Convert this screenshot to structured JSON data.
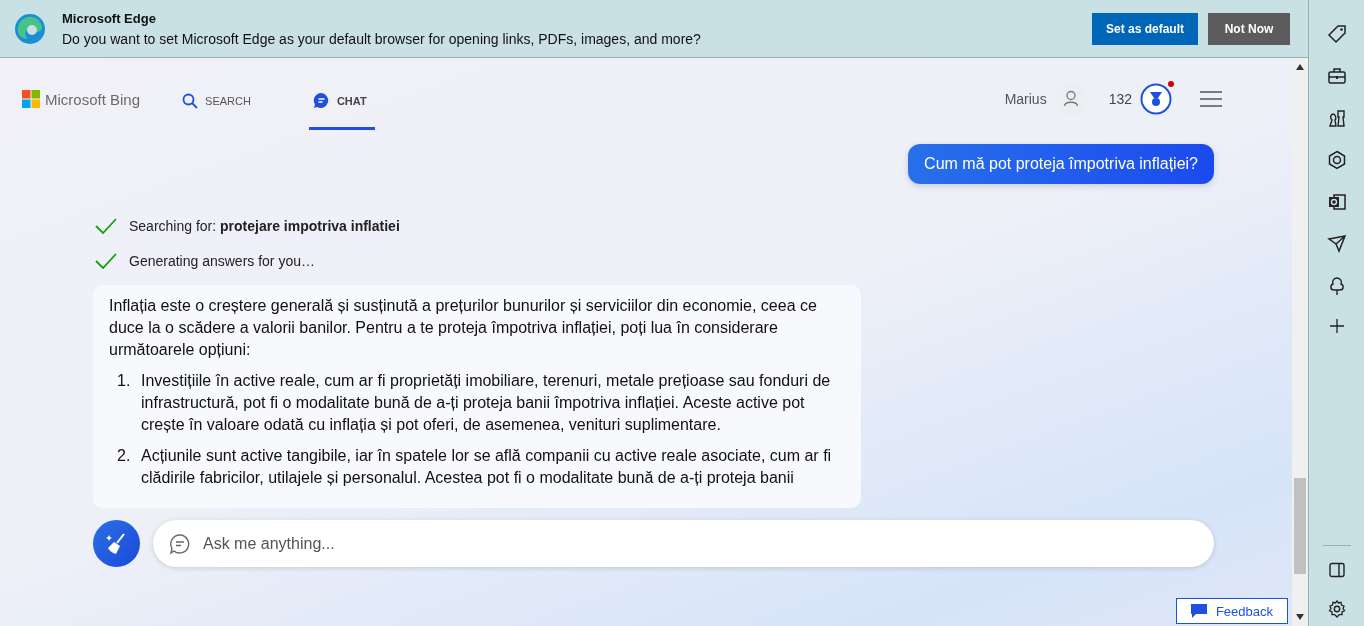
{
  "banner": {
    "title": "Microsoft Edge",
    "message": "Do you want to set Microsoft Edge as your default browser for opening links, PDFs, images, and more?",
    "buttons": [
      {
        "label": "Set as default",
        "kind": "primary"
      },
      {
        "label": "Not Now",
        "kind": "secondary"
      }
    ]
  },
  "header": {
    "logo": "Microsoft Bing",
    "tabs": [
      {
        "label": "SEARCH",
        "selected": false
      },
      {
        "label": "CHAT",
        "selected": true
      }
    ],
    "user": "Marius",
    "points": "132",
    "rewards_notification": true
  },
  "chat": {
    "user_message": "Cum mă pot proteja împotriva inflației?",
    "steps": [
      {
        "text": "Searching for: **protejare impotriva inflatiei**",
        "done": true
      },
      {
        "text": "Generating answers for you…",
        "done": true
      }
    ],
    "answer": {
      "intro": "Inflația este o creștere generală și susținută a prețurilor bunurilor și serviciilor din economie, ceea ce duce la o scădere a valorii banilor. Pentru a te proteja împotriva inflației, poți lua în considerare următoarele opțiuni:",
      "items": [
        {
          "number": "1.",
          "text": "Investițiile în active reale, cum ar fi proprietăți imobiliare, terenuri, metale prețioase sau fonduri de infrastructură, pot fi o modalitate bună de a-ți proteja banii împotriva inflației. Aceste active pot crește în valoare odată cu inflația și pot oferi, de asemenea, venituri suplimentare."
        },
        {
          "number": "2.",
          "text": "Acțiunile sunt active tangibile, iar în spatele lor se află companii cu active reale asociate, cum ar fi clădirile fabricilor, utilajele și personalul. Acestea pot fi o modalitate bună de a-ți proteja banii"
        }
      ]
    }
  },
  "input": {
    "placeholder": "Ask me anything..."
  },
  "feedback": "Feedback"
}
